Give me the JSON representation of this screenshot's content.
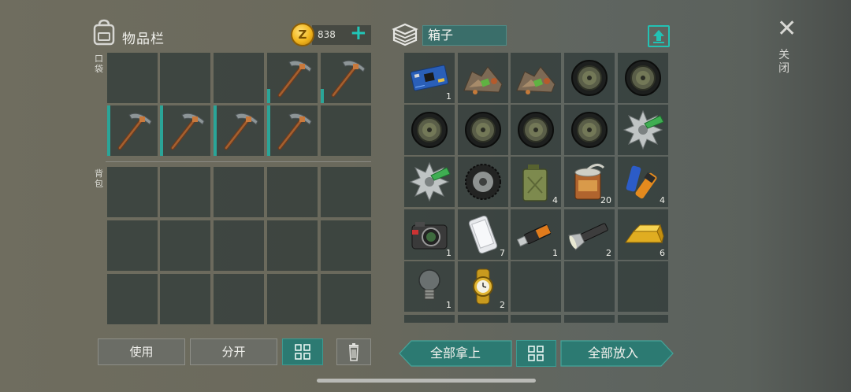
{
  "inventory": {
    "title": "物品栏",
    "coin_symbol": "Z",
    "coins": "838",
    "plus_label": "+",
    "pocket_label": "口袋",
    "backpack_label": "背包",
    "pocket_slots": [
      {
        "item": "",
        "count": ""
      },
      {
        "item": "",
        "count": ""
      },
      {
        "item": "",
        "count": ""
      },
      {
        "item": "pickaxe-icon",
        "count": ""
      },
      {
        "item": "pickaxe-icon",
        "count": ""
      },
      {
        "item": "pickaxe-icon",
        "count": ""
      },
      {
        "item": "pickaxe-icon",
        "count": ""
      },
      {
        "item": "pickaxe-icon",
        "count": ""
      },
      {
        "item": "pickaxe-icon",
        "count": ""
      },
      {
        "item": "",
        "count": ""
      }
    ],
    "backpack_slot_count": 15
  },
  "container": {
    "name": "箱子",
    "slots": [
      {
        "item": "circuit-board-icon",
        "count": "1"
      },
      {
        "item": "scrap-pile-icon",
        "count": ""
      },
      {
        "item": "scrap-pile-icon",
        "count": ""
      },
      {
        "item": "wheel-hub-icon",
        "count": ""
      },
      {
        "item": "wheel-hub-icon",
        "count": ""
      },
      {
        "item": "wheel-hub-icon",
        "count": ""
      },
      {
        "item": "wheel-hub-icon",
        "count": ""
      },
      {
        "item": "wheel-hub-icon",
        "count": ""
      },
      {
        "item": "wheel-hub-icon",
        "count": ""
      },
      {
        "item": "saw-blade-icon",
        "count": ""
      },
      {
        "item": "saw-blade-icon",
        "count": ""
      },
      {
        "item": "tire-icon",
        "count": ""
      },
      {
        "item": "jerrycan-icon",
        "count": "4"
      },
      {
        "item": "food-can-icon",
        "count": "20"
      },
      {
        "item": "batteries-icon",
        "count": "4"
      },
      {
        "item": "camera-icon",
        "count": "1"
      },
      {
        "item": "smartphone-icon",
        "count": "7"
      },
      {
        "item": "usb-drive-icon",
        "count": "1"
      },
      {
        "item": "flashlight-icon",
        "count": "2"
      },
      {
        "item": "gold-bar-icon",
        "count": "6"
      },
      {
        "item": "light-bulb-icon",
        "count": "1"
      },
      {
        "item": "wristwatch-icon",
        "count": "2"
      },
      {
        "item": "",
        "count": ""
      },
      {
        "item": "",
        "count": ""
      },
      {
        "item": "",
        "count": ""
      }
    ]
  },
  "close_label": "关闭",
  "buttons": {
    "use": "使用",
    "split": "分开",
    "take_all": "全部拿上",
    "put_all": "全部放入"
  },
  "colors": {
    "accent": "#22c2b4",
    "slot_bg": "#2d3736",
    "button_teal": "#2c7a72"
  }
}
